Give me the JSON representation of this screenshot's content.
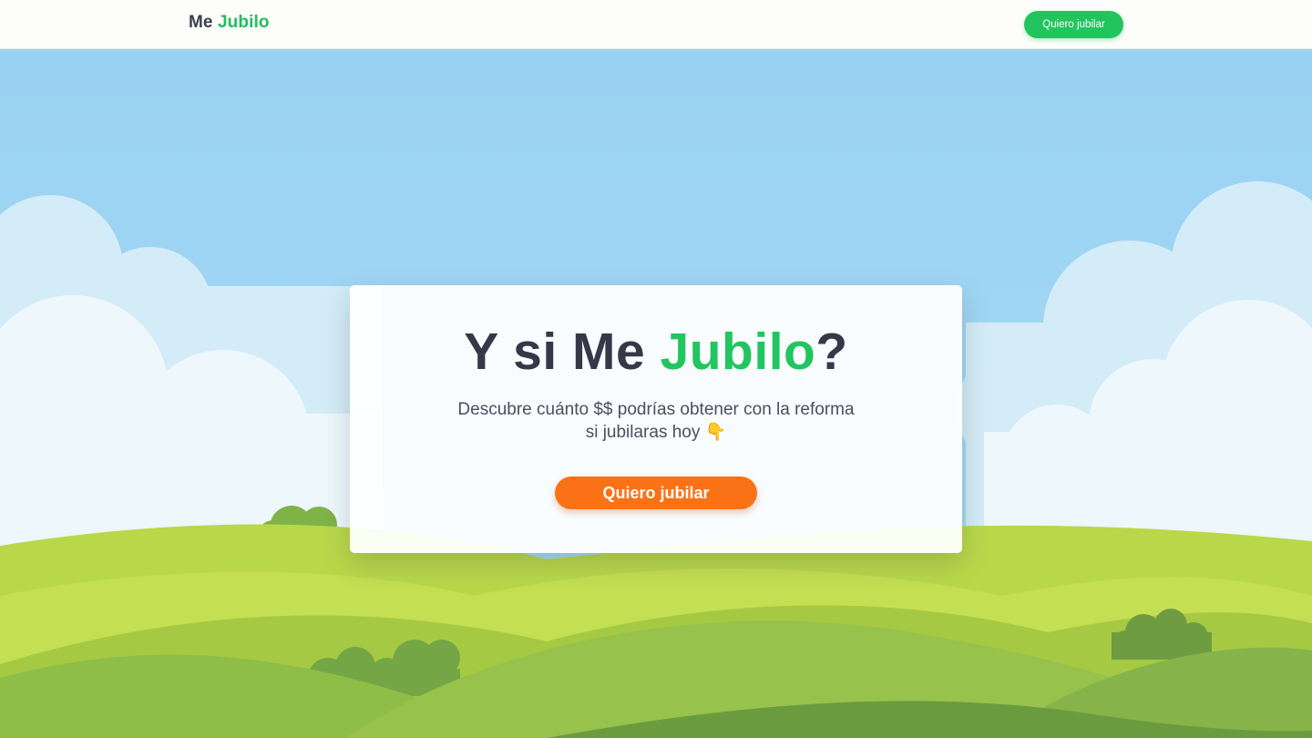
{
  "header": {
    "logo_part1": "Me",
    "logo_part2": "Jubilo",
    "cta_label": "Quiero jubilar"
  },
  "hero": {
    "title_part1": "Y si Me",
    "title_part2": "Jubilo",
    "title_part3": "?",
    "subtitle_line1": "Descubre cuánto $$ podrías obtener con la reforma",
    "subtitle_line2": "si jubilaras hoy 👇",
    "cta_label": "Quiero jubilar"
  },
  "colors": {
    "brand_green": "#22c55e",
    "cta_orange": "#fb7216",
    "text_dark": "#363848",
    "sky": "#9bd3f3"
  }
}
